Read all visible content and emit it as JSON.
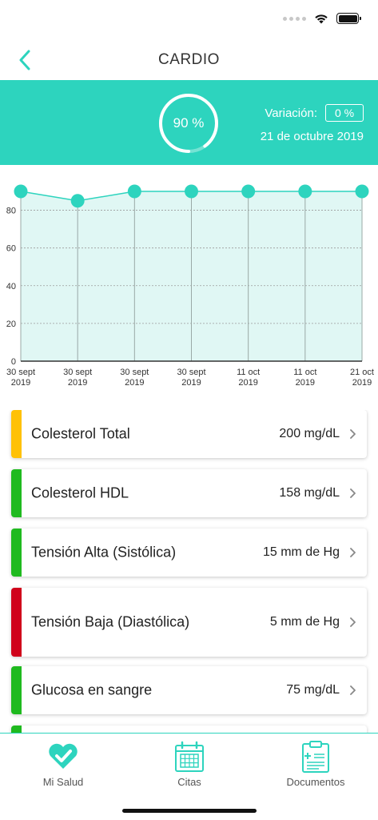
{
  "header": {
    "title": "CARDIO",
    "back_icon": "chevron-left-icon"
  },
  "summary": {
    "score_text": "90 %",
    "score_fraction": 0.9,
    "variation_label": "Variación:",
    "variation_value": "0 %",
    "date": "21 de octubre 2019"
  },
  "colors": {
    "accent": "#2dd4be",
    "yellow": "#ffc107",
    "green": "#1fba1f",
    "red": "#d0021b"
  },
  "chart_data": {
    "type": "line",
    "x": [
      [
        "30 sept",
        "2019"
      ],
      [
        "30 sept",
        "2019"
      ],
      [
        "30 sept",
        "2019"
      ],
      [
        "30 sept",
        "2019"
      ],
      [
        "11 oct",
        "2019"
      ],
      [
        "11 oct",
        "2019"
      ],
      [
        "21 oct",
        "2019"
      ]
    ],
    "series": [
      {
        "values": [
          90,
          85,
          90,
          90,
          90,
          90,
          90
        ]
      }
    ],
    "yticks": [
      0,
      20,
      40,
      60,
      80
    ],
    "ylim": [
      0,
      90
    ],
    "grid": true,
    "title": "",
    "xlabel": "",
    "ylabel": ""
  },
  "metrics": [
    {
      "name": "Colesterol Total",
      "value": "200 mg/dL",
      "status_color": "#ffc107"
    },
    {
      "name": "Colesterol HDL",
      "value": "158 mg/dL",
      "status_color": "#1fba1f"
    },
    {
      "name": "Tensión Alta (Sistólica)",
      "value": "15 mm de Hg",
      "status_color": "#1fba1f"
    },
    {
      "name": "Tensión Baja (Diastólica)",
      "value": "5 mm de Hg",
      "status_color": "#d0021b"
    },
    {
      "name": "Glucosa en sangre",
      "value": "75 mg/dL",
      "status_color": "#1fba1f"
    },
    {
      "name": "",
      "value": "",
      "status_color": "#1fba1f"
    }
  ],
  "tabs": [
    {
      "label": "Mi Salud",
      "icon": "heart-check-icon"
    },
    {
      "label": "Citas",
      "icon": "calendar-icon"
    },
    {
      "label": "Documentos",
      "icon": "clipboard-icon"
    }
  ]
}
